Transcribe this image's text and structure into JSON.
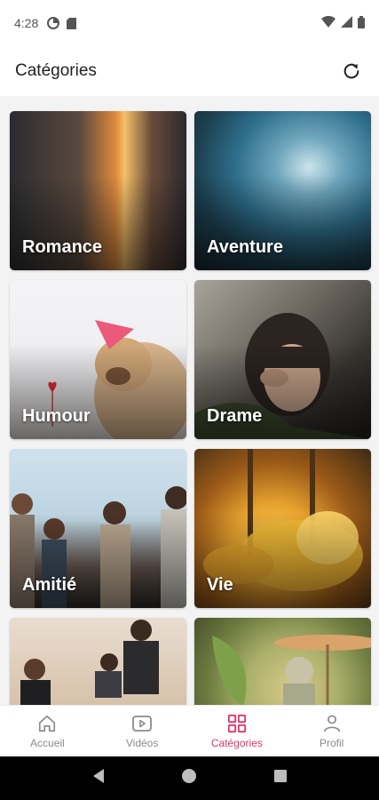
{
  "status_bar": {
    "time": "4:28"
  },
  "app_bar": {
    "title": "Catégories"
  },
  "categories": [
    {
      "label": "Romance"
    },
    {
      "label": "Aventure"
    },
    {
      "label": "Humour"
    },
    {
      "label": "Drame"
    },
    {
      "label": "Amitié"
    },
    {
      "label": "Vie"
    },
    {
      "label": ""
    },
    {
      "label": ""
    }
  ],
  "bottom_nav": {
    "items": [
      {
        "label": "Accueil",
        "icon": "home-icon"
      },
      {
        "label": "Vidéos",
        "icon": "video-icon"
      },
      {
        "label": "Catégories",
        "icon": "grid-icon"
      },
      {
        "label": "Profil",
        "icon": "person-icon"
      }
    ],
    "active_index": 2,
    "active_color": "#e2336b",
    "inactive_color": "#8a8a8a"
  }
}
